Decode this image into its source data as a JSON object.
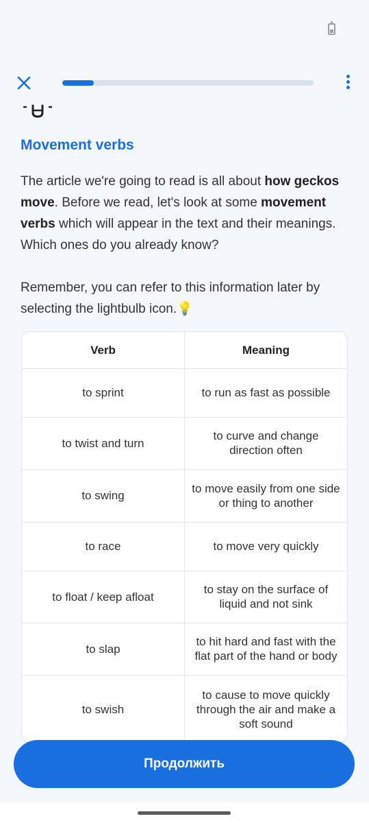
{
  "status_bar": {
    "battery_icon": "battery-icon"
  },
  "header": {
    "close_icon": "close-icon",
    "progress": 0.125,
    "menu_icon": "more-vertical-icon",
    "accent_color": "#1a6fe0"
  },
  "lesson": {
    "title": "Movement verbs",
    "intro": {
      "t1": "The article we're going to read is all about ",
      "b1": "how geckos move",
      "t2": ". Before we read, let's look at some ",
      "b2": "movement verbs",
      "t3": " which will appear in the text and their meanings. Which ones do you already know?"
    },
    "reminder": {
      "text": "Remember, you can refer to this information later by selecting the lightbulb icon.",
      "emoji": "💡"
    }
  },
  "table": {
    "headers": [
      "Verb",
      "Meaning"
    ],
    "rows": [
      {
        "verb": "to sprint",
        "meaning": "to run as fast as possible"
      },
      {
        "verb": "to twist and turn",
        "meaning": "to curve and change direction often"
      },
      {
        "verb": "to swing",
        "meaning": "to move easily from one side or thing to another"
      },
      {
        "verb": "to race",
        "meaning": "to move very quickly"
      },
      {
        "verb": "to float / keep afloat",
        "meaning": "to stay on the surface of liquid and not sink"
      },
      {
        "verb": "to slap",
        "meaning": "to hit hard and fast with the flat part of the hand or body"
      },
      {
        "verb": "to swish",
        "meaning": "to cause to move quickly through the air and make a soft sound"
      }
    ]
  },
  "footer": {
    "continue_label": "Продолжить"
  }
}
